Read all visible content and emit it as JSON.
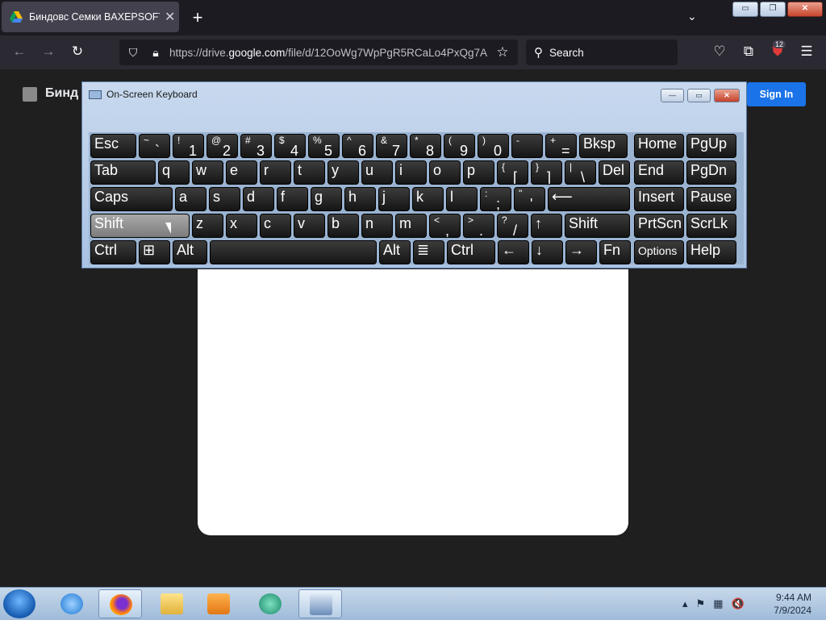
{
  "browser": {
    "tab_title": "Биндовс Семки BAXEPSOFT RT",
    "tab_close": "✕",
    "new_tab": "+",
    "tabs_menu": "⌄",
    "window_buttons": {
      "minimize": "▭",
      "restore": "❐",
      "close": "✕"
    },
    "nav": {
      "back": "←",
      "forward": "→",
      "reload": "↻"
    },
    "url_prefix": "https://drive.",
    "url_domain": "google.com",
    "url_rest": "/file/d/12OoWg7WpPgR5RCaLo4PxQg7A",
    "search_placeholder": "Search",
    "extension_badge": "12",
    "menu": "☰"
  },
  "page": {
    "doc_title": "Бинд",
    "sign_in": "Sign In"
  },
  "osk": {
    "title": "On-Screen Keyboard",
    "buttons": {
      "minimize": "—",
      "restore": "▭",
      "close": "✕"
    },
    "rows": [
      [
        {
          "label": "Esc"
        },
        {
          "shift": "~",
          "char": "`"
        },
        {
          "shift": "!",
          "char": "1"
        },
        {
          "shift": "@",
          "char": "2"
        },
        {
          "shift": "#",
          "char": "3"
        },
        {
          "shift": "$",
          "char": "4"
        },
        {
          "shift": "%",
          "char": "5"
        },
        {
          "shift": "^",
          "char": "6"
        },
        {
          "shift": "&",
          "char": "7"
        },
        {
          "shift": "*",
          "char": "8"
        },
        {
          "shift": "(",
          "char": "9"
        },
        {
          "shift": ")",
          "char": "0"
        },
        {
          "shift": "-",
          "char": "_"
        },
        {
          "shift": "+",
          "char": "="
        },
        {
          "label": "Bksp"
        },
        {
          "label": "Home"
        },
        {
          "label": "PgUp"
        }
      ],
      [
        {
          "label": "Tab"
        },
        {
          "label": "q"
        },
        {
          "label": "w"
        },
        {
          "label": "e"
        },
        {
          "label": "r"
        },
        {
          "label": "t"
        },
        {
          "label": "y"
        },
        {
          "label": "u"
        },
        {
          "label": "i"
        },
        {
          "label": "o"
        },
        {
          "label": "p"
        },
        {
          "shift": "{",
          "char": "["
        },
        {
          "shift": "}",
          "char": "]"
        },
        {
          "shift": "|",
          "char": "\\"
        },
        {
          "label": "Del"
        },
        {
          "label": "End"
        },
        {
          "label": "PgDn"
        }
      ],
      [
        {
          "label": "Caps"
        },
        {
          "label": "a"
        },
        {
          "label": "s"
        },
        {
          "label": "d"
        },
        {
          "label": "f"
        },
        {
          "label": "g"
        },
        {
          "label": "h"
        },
        {
          "label": "j"
        },
        {
          "label": "k"
        },
        {
          "label": "l"
        },
        {
          "shift": ":",
          "char": ";"
        },
        {
          "shift": "\"",
          "char": "'"
        },
        {
          "label": "⟵"
        },
        {
          "label": "Insert"
        },
        {
          "label": "Pause"
        }
      ],
      [
        {
          "label": "Shift",
          "selected": true
        },
        {
          "label": "z"
        },
        {
          "label": "x"
        },
        {
          "label": "c"
        },
        {
          "label": "v"
        },
        {
          "label": "b"
        },
        {
          "label": "n"
        },
        {
          "label": "m"
        },
        {
          "shift": "<",
          "char": ","
        },
        {
          "shift": ">",
          "char": "."
        },
        {
          "shift": "?",
          "char": "/"
        },
        {
          "label": "↑"
        },
        {
          "label": "Shift"
        },
        {
          "label": "PrtScn"
        },
        {
          "label": "ScrLk"
        }
      ],
      [
        {
          "label": "Ctrl"
        },
        {
          "label": "⊞"
        },
        {
          "label": "Alt"
        },
        {
          "label": ""
        },
        {
          "label": "Alt"
        },
        {
          "label": "≣"
        },
        {
          "label": "Ctrl"
        },
        {
          "label": "←"
        },
        {
          "label": "↓"
        },
        {
          "label": "→"
        },
        {
          "label": "Fn"
        },
        {
          "label": "Options",
          "small": true
        },
        {
          "label": "Help"
        }
      ]
    ]
  },
  "taskbar": {
    "time": "9:44 AM",
    "date": "7/9/2024",
    "tray_up": "▴",
    "tray_flag": "⚑",
    "tray_network": "▦",
    "tray_volume": "🔇"
  }
}
